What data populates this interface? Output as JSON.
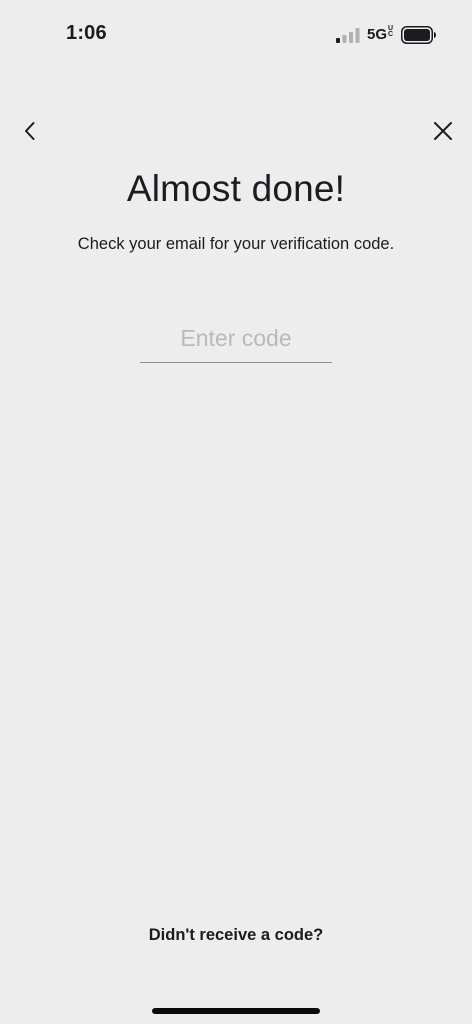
{
  "status_bar": {
    "time": "1:06",
    "network": "5G",
    "network_suffix": "UC",
    "signal_icon": "cellular-signal-icon",
    "battery_icon": "battery-icon"
  },
  "nav": {
    "back_icon": "chevron-left-icon",
    "close_icon": "close-icon"
  },
  "content": {
    "title": "Almost done!",
    "subtitle": "Check your email for your verification code.",
    "code_input": {
      "value": "",
      "placeholder": "Enter code"
    },
    "resend_label": "Didn't receive a code?"
  },
  "colors": {
    "background": "#ededed",
    "text": "#1c1c1e",
    "placeholder": "#b9b9b9",
    "underline": "#8e8e8e"
  }
}
